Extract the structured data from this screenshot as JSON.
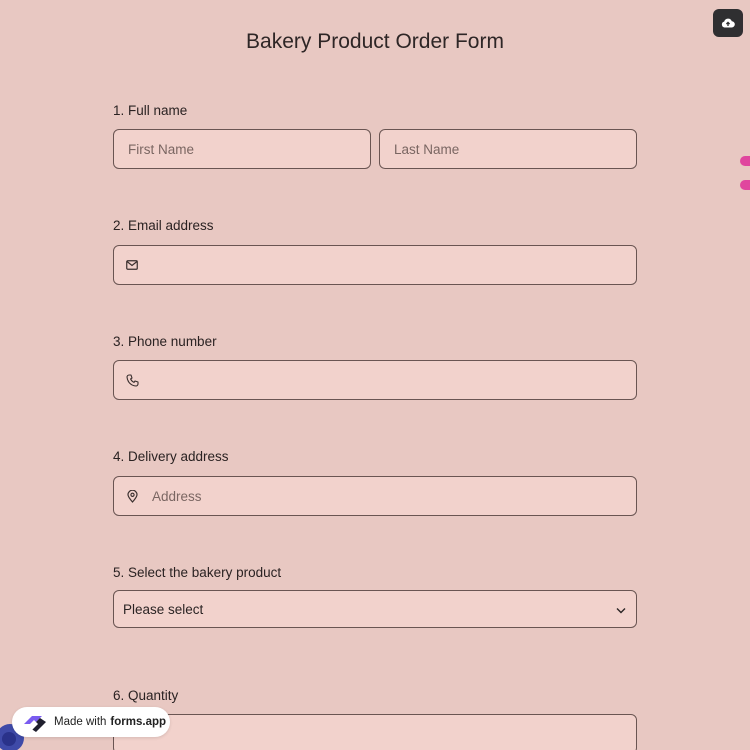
{
  "form": {
    "title": "Bakery Product Order Form",
    "questions": [
      {
        "label": "1.  Full name",
        "first_placeholder": "First Name",
        "last_placeholder": "Last Name"
      },
      {
        "label": "2. Email address",
        "icon": "envelope-icon"
      },
      {
        "label": "3. Phone number",
        "icon": "phone-icon"
      },
      {
        "label": "4. Delivery address",
        "icon": "map-pin-icon",
        "placeholder": "Address"
      },
      {
        "label": "5. Select the bakery product",
        "selected": "Please select",
        "icon": "chevron-down-icon"
      },
      {
        "label": "6. Quantity"
      }
    ]
  },
  "toolbar": {
    "save_icon": "cloud-upload-icon"
  },
  "branding": {
    "made_with": "Made with",
    "brand": "forms.app"
  },
  "colors": {
    "background": "#e8c8c2",
    "field_bg": "#f2d2cc",
    "accent": "#e0469e",
    "brand": "#3f4aa8"
  }
}
